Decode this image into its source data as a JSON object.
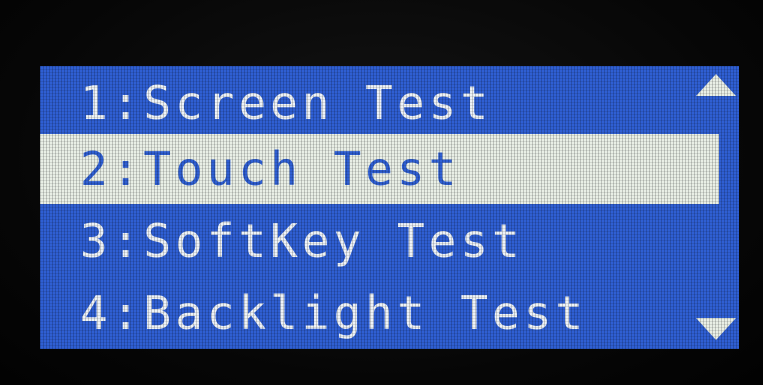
{
  "menu": {
    "items": [
      {
        "label": "1:Screen Test",
        "selected": false
      },
      {
        "label": "2:Touch Test",
        "selected": true
      },
      {
        "label": "3:SoftKey Test",
        "selected": false
      },
      {
        "label": "4:Backlight Test",
        "selected": false
      }
    ]
  },
  "scrollbar": {
    "up_icon": "triangle-up",
    "down_icon": "triangle-down"
  },
  "colors": {
    "lcd_background": "#2f5fd3",
    "text": "#eef3f8",
    "highlight": "#e9efe6",
    "bezel": "#050505"
  }
}
